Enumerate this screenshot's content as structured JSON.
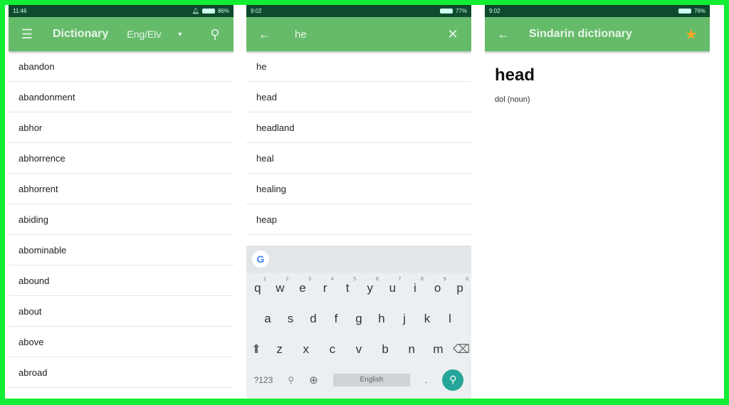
{
  "panels": [
    {
      "status": {
        "time": "11:46",
        "battery": "86%"
      },
      "appbar": {
        "title": "Dictionary",
        "language": "Eng/Elv"
      },
      "words": [
        "abandon",
        "abandonment",
        "abhor",
        "abhorrence",
        "abhorrent",
        "abiding",
        "abominable",
        "abound",
        "about",
        "above",
        "abroad"
      ]
    },
    {
      "status": {
        "time": "9:02",
        "battery": "77%"
      },
      "search": {
        "query": "he"
      },
      "results": [
        "he",
        "head",
        "headland",
        "heal",
        "healing",
        "heap"
      ],
      "keyboard": {
        "row1": [
          "q",
          "w",
          "e",
          "r",
          "t",
          "y",
          "u",
          "i",
          "o",
          "p"
        ],
        "row1_nums": [
          "1",
          "2",
          "3",
          "4",
          "5",
          "6",
          "7",
          "8",
          "9",
          "0"
        ],
        "row2": [
          "a",
          "s",
          "d",
          "f",
          "g",
          "h",
          "j",
          "k",
          "l"
        ],
        "row3": [
          "z",
          "x",
          "c",
          "v",
          "b",
          "n",
          "m"
        ],
        "symbols": "?123",
        "space": "English",
        "period": "."
      }
    },
    {
      "status": {
        "time": "9:02",
        "battery": "76%"
      },
      "appbar": {
        "title": "Sindarin dictionary"
      },
      "entry": {
        "word": "head",
        "translation": "dol (noun)"
      }
    }
  ],
  "colors": {
    "appbar": "#66bb6a",
    "statusbar": "#0e4a2c",
    "frame": "#11ee33",
    "star": "#f5a623"
  }
}
